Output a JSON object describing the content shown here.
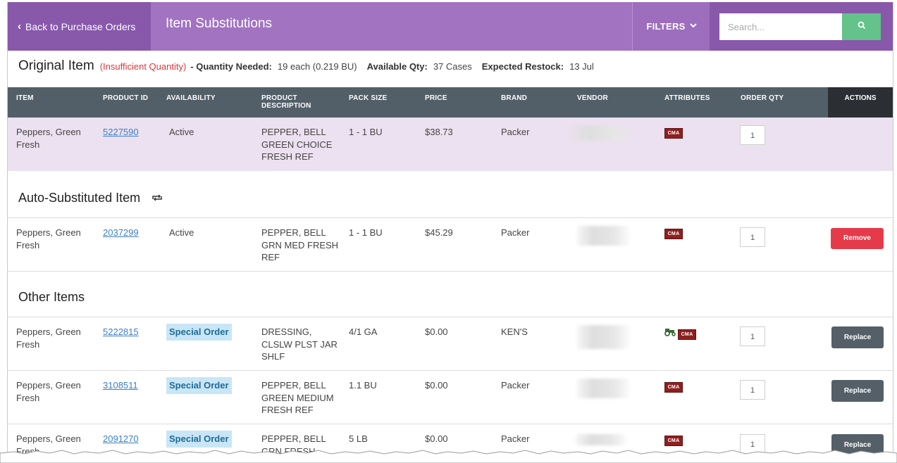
{
  "header": {
    "back_label": "Back to Purchase Orders",
    "title": "Item Substitutions",
    "filters_label": "FILTERS",
    "search_placeholder": "Search..."
  },
  "original_info": {
    "title": "Original Item",
    "status": "(Insufficient Quantity)",
    "qty_needed_label": "- Quantity Needed:",
    "qty_needed_value": "19 each (0.219 BU)",
    "available_label": "Available Qty:",
    "available_value": "37 Cases",
    "restock_label": "Expected Restock:",
    "restock_value": "13 Jul"
  },
  "columns": [
    "ITEM",
    "PRODUCT ID",
    "AVAILABILITY",
    "PRODUCT DESCRIPTION",
    "PACK SIZE",
    "PRICE",
    "BRAND",
    "VENDOR",
    "ATTRIBUTES",
    "ORDER QTY",
    "ACTIONS"
  ],
  "column_lines": {
    "desc_line1": "PRODUCT",
    "desc_line2": "DESCRIPTION"
  },
  "original_row": {
    "item": "Peppers, Green Fresh",
    "product_id": "5227590",
    "availability": "Active",
    "description": "PEPPER, BELL GREEN CHOICE FRESH REF",
    "pack_size": "1 - 1 BU",
    "price": "$38.73",
    "brand": "Packer",
    "attribute": "CMA",
    "qty": "1"
  },
  "auto_section": {
    "title": "Auto-Substituted Item",
    "icon": "swap-icon"
  },
  "auto_row": {
    "item": "Peppers, Green Fresh",
    "product_id": "2037299",
    "availability": "Active",
    "description": "PEPPER, BELL GRN MED FRESH REF",
    "pack_size": "1 - 1 BU",
    "price": "$45.29",
    "brand": "Packer",
    "attribute": "CMA",
    "qty": "1",
    "action": "Remove"
  },
  "other_section": {
    "title": "Other Items"
  },
  "other_rows": [
    {
      "item": "Peppers, Green Fresh",
      "product_id": "5222815",
      "availability": "Special Order",
      "description": "DRESSING, CLSLW PLST JAR SHLF",
      "pack_size": "4/1 GA",
      "price": "$0.00",
      "brand": "KEN'S",
      "attribute": "CMA",
      "extra_icon": "tractor-icon",
      "qty": "1",
      "action": "Replace"
    },
    {
      "item": "Peppers, Green Fresh",
      "product_id": "3108511",
      "availability": "Special Order",
      "description": "PEPPER, BELL GREEN MEDIUM FRESH REF",
      "pack_size": "1.1 BU",
      "price": "$0.00",
      "brand": "Packer",
      "attribute": "CMA",
      "qty": "1",
      "action": "Replace"
    },
    {
      "item": "Peppers, Green Fresh",
      "product_id": "2091270",
      "availability": "Special Order",
      "description": "PEPPER, BELL GRN FRESH",
      "pack_size": "5 LB",
      "price": "$0.00",
      "brand": "Packer",
      "attribute": "CMA",
      "qty": "1",
      "action": "Replace"
    }
  ],
  "colors": {
    "header_purple": "#a173c0",
    "back_purple": "#8858ab",
    "search_green": "#63c38a",
    "table_header": "#525f69",
    "actions_header": "#2b2f33",
    "highlight_row": "#ece1f0",
    "remove_red": "#e53a4a",
    "replace_gray": "#545f68",
    "cma_red": "#8e2020",
    "special_bg": "#c8e6f5"
  }
}
